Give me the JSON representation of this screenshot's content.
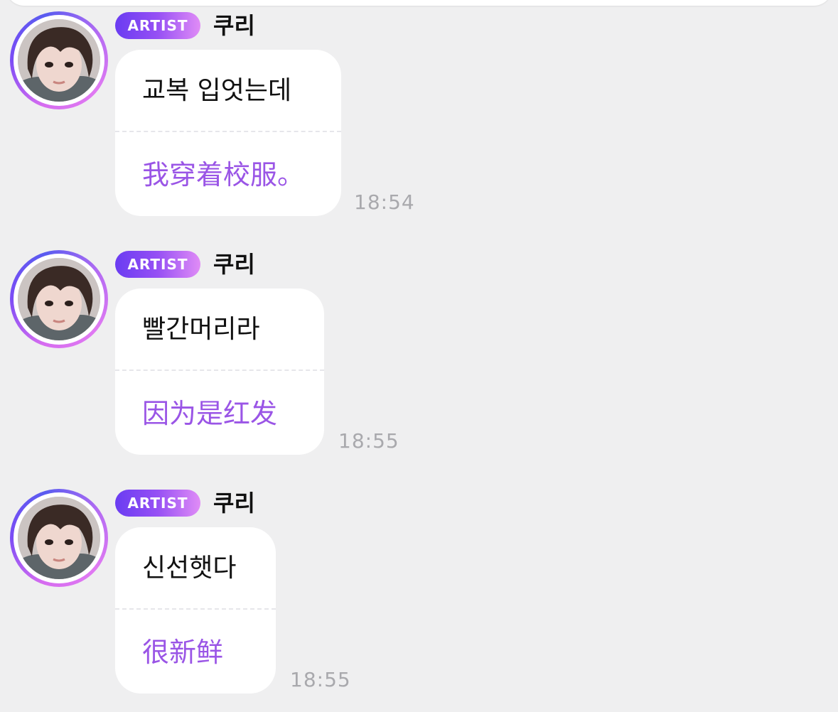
{
  "messages": [
    {
      "badge": "ARTIST",
      "name": "쿠리",
      "original": "교복 입엇는데",
      "translation": "我穿着校服。",
      "time": "18:54"
    },
    {
      "badge": "ARTIST",
      "name": "쿠리",
      "original": "빨간머리라",
      "translation": "因为是红发",
      "time": "18:55"
    },
    {
      "badge": "ARTIST",
      "name": "쿠리",
      "original": "신선햇다",
      "translation": "很新鲜",
      "time": "18:55"
    }
  ],
  "colors": {
    "background": "#efeff0",
    "bubble": "#ffffff",
    "translation_text": "#9a55e6",
    "badge_gradient_start": "#6a3cf2",
    "badge_gradient_end": "#e08cf6",
    "timestamp": "#a9a9ad"
  },
  "icons": {
    "avatar": "artist-profile-photo"
  }
}
